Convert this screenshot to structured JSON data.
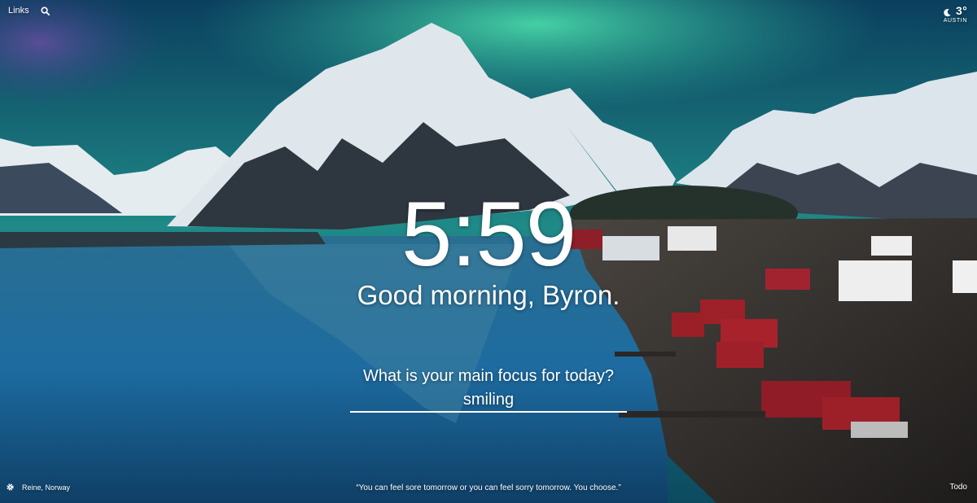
{
  "top_left": {
    "links_label": "Links",
    "search_icon": "search-icon"
  },
  "weather": {
    "icon": "moon-icon",
    "temperature": "3°",
    "location": "AUSTIN"
  },
  "clock": {
    "time": "5:59"
  },
  "greeting": {
    "text": "Good morning, Byron."
  },
  "focus": {
    "question": "What is your main focus for today?",
    "value": "smiling"
  },
  "bottom": {
    "settings_icon": "gear-icon",
    "photo_location": "Reine, Norway",
    "quote": "“You can feel sore tomorrow or you can feel sorry tomorrow. You choose.”",
    "todo_label": "Todo"
  }
}
